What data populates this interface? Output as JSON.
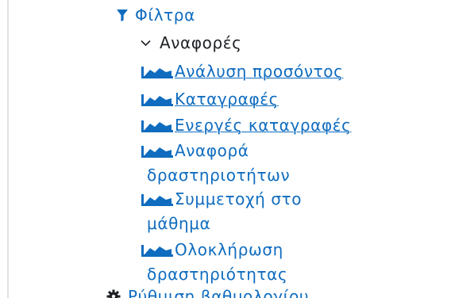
{
  "nav": {
    "filters": {
      "label": "Φίλτρα",
      "icon": "filter-icon"
    },
    "reports": {
      "label": "Αναφορές",
      "icon": "chevron-down-icon",
      "expanded": true
    },
    "report_items": [
      {
        "icon": "area-chart-icon",
        "line1": "Ανάλυση προσόντος",
        "line2": ""
      },
      {
        "icon": "area-chart-icon",
        "line1": "Καταγραφές",
        "line2": ""
      },
      {
        "icon": "area-chart-icon",
        "line1": "Ενεργές καταγραφές",
        "line2": ""
      },
      {
        "icon": "area-chart-icon",
        "line1": "Αναφορά",
        "line2": "δραστηριοτήτων"
      },
      {
        "icon": "area-chart-icon",
        "line1": "Συμμετοχή στο",
        "line2": "μάθημα"
      },
      {
        "icon": "area-chart-icon",
        "line1": "Ολοκλήρωση",
        "line2": "δραστηριότητας"
      }
    ],
    "gradebook_setup": {
      "label": "Ρύθμιση βαθμολογίου",
      "icon": "gear-icon"
    }
  },
  "colors": {
    "link": "#0f6cbf",
    "text": "#1d2125",
    "border": "#dfe2e6"
  }
}
